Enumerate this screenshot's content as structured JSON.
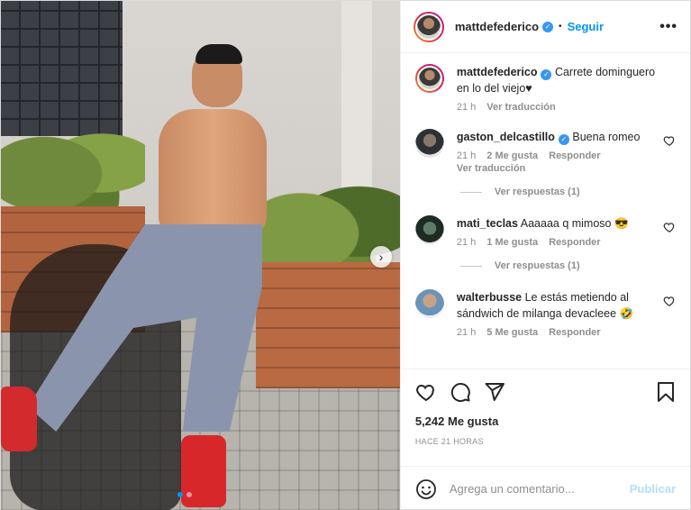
{
  "header": {
    "username": "mattdefederico",
    "separator": "•",
    "follow_label": "Seguir",
    "more_label": "•••"
  },
  "caption": {
    "username": "mattdefederico",
    "text": "Carrete dominguero en lo del viejo♥",
    "time": "21 h",
    "translate": "Ver traducción"
  },
  "comments": [
    {
      "username": "gaston_delcastillo",
      "verified": true,
      "text": "Buena romeo",
      "time": "21 h",
      "likes": "2 Me gusta",
      "reply": "Responder",
      "translate": "Ver traducción",
      "view_replies": "Ver respuestas (1)"
    },
    {
      "username": "mati_teclas",
      "text": "Aaaaaa q mimoso 😎",
      "time": "21 h",
      "likes": "1 Me gusta",
      "reply": "Responder",
      "view_replies": "Ver respuestas (1)"
    },
    {
      "username": "walterbusse",
      "text": "Le estás metiendo al sándwich de milanga devacleee 🤣",
      "time": "21 h",
      "likes": "5 Me gusta",
      "reply": "Responder"
    }
  ],
  "actions": {
    "likes": "5,242 Me gusta",
    "timestamp": "HACE 21 HORAS"
  },
  "add_comment": {
    "placeholder": "Agrega un comentario...",
    "publish": "Publicar"
  },
  "carousel": {
    "next_label": "›"
  },
  "colors": {
    "accent": "#0095f6",
    "verified": "#3897f0",
    "publish_disabled": "#b2dffc"
  }
}
